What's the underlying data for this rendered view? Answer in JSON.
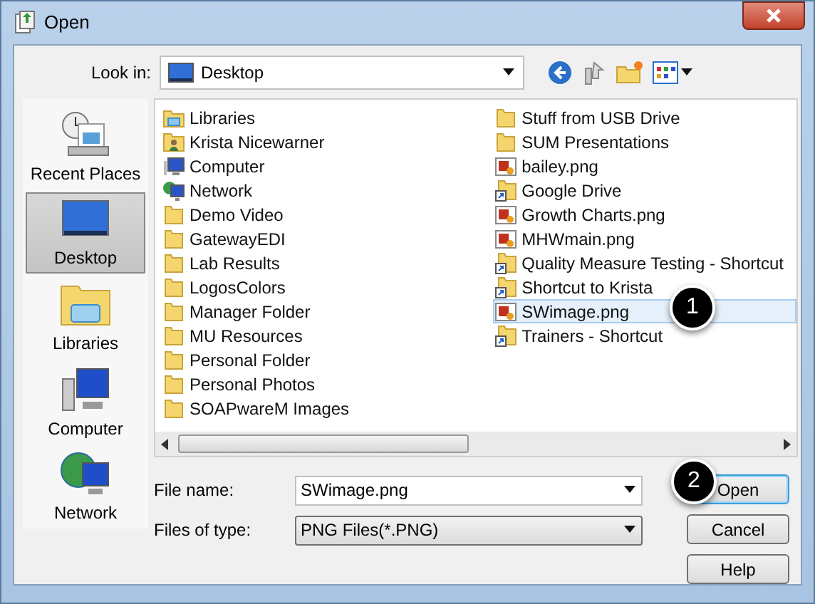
{
  "window": {
    "title": "Open"
  },
  "look_in": {
    "label": "Look in:",
    "value": "Desktop"
  },
  "places": [
    {
      "label": "Recent Places",
      "kind": "recent",
      "selected": false
    },
    {
      "label": "Desktop",
      "kind": "desktop",
      "selected": true
    },
    {
      "label": "Libraries",
      "kind": "libraries",
      "selected": false
    },
    {
      "label": "Computer",
      "kind": "computer",
      "selected": false
    },
    {
      "label": "Network",
      "kind": "network",
      "selected": false
    }
  ],
  "files": [
    {
      "name": "Libraries",
      "kind": "libraries",
      "selected": false
    },
    {
      "name": "Krista Nicewarner",
      "kind": "user",
      "selected": false
    },
    {
      "name": "Computer",
      "kind": "computer",
      "selected": false
    },
    {
      "name": "Network",
      "kind": "network",
      "selected": false
    },
    {
      "name": "Demo Video",
      "kind": "folder",
      "selected": false
    },
    {
      "name": "GatewayEDI",
      "kind": "folder",
      "selected": false
    },
    {
      "name": "Lab Results",
      "kind": "folder",
      "selected": false
    },
    {
      "name": "LogosColors",
      "kind": "folder",
      "selected": false
    },
    {
      "name": "Manager Folder",
      "kind": "folder",
      "selected": false
    },
    {
      "name": "MU Resources",
      "kind": "folder",
      "selected": false
    },
    {
      "name": "Personal Folder",
      "kind": "folder",
      "selected": false
    },
    {
      "name": "Personal Photos",
      "kind": "folder",
      "selected": false
    },
    {
      "name": "SOAPwareM Images",
      "kind": "folder",
      "selected": false
    },
    {
      "name": "Stuff from USB Drive",
      "kind": "folder",
      "selected": false
    },
    {
      "name": "SUM Presentations",
      "kind": "folder",
      "selected": false
    },
    {
      "name": "bailey.png",
      "kind": "image",
      "selected": false
    },
    {
      "name": "Google Drive",
      "kind": "shortcut",
      "selected": false
    },
    {
      "name": "Growth Charts.png",
      "kind": "image",
      "selected": false
    },
    {
      "name": "MHWmain.png",
      "kind": "image",
      "selected": false
    },
    {
      "name": "Quality Measure Testing - Shortcut",
      "kind": "shortcut",
      "selected": false
    },
    {
      "name": "Shortcut to Krista",
      "kind": "shortcut",
      "selected": false
    },
    {
      "name": "SWimage.png",
      "kind": "image",
      "selected": true
    },
    {
      "name": "Trainers - Shortcut",
      "kind": "shortcut",
      "selected": false
    }
  ],
  "file_name": {
    "label": "File name:",
    "value": "SWimage.png"
  },
  "file_type": {
    "label": "Files of type:",
    "value": "PNG Files(*.PNG)"
  },
  "buttons": [
    {
      "label": "Open",
      "default": true
    },
    {
      "label": "Cancel",
      "default": false
    },
    {
      "label": "Help",
      "default": false
    }
  ],
  "annotations": [
    {
      "label": "1"
    },
    {
      "label": "2"
    }
  ]
}
